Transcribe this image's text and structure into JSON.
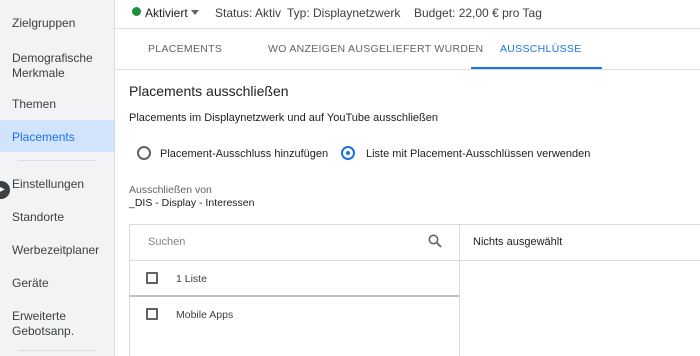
{
  "sidebar": {
    "items": [
      {
        "label": "Zielgruppen"
      },
      {
        "label": "Demografische Merkmale"
      },
      {
        "label": "Themen"
      },
      {
        "label": "Placements"
      },
      {
        "label": "Einstellungen"
      },
      {
        "label": "Standorte"
      },
      {
        "label": "Werbezeitplaner"
      },
      {
        "label": "Geräte"
      },
      {
        "label": "Erweiterte Gebotsanp."
      }
    ],
    "active_item": "Placements"
  },
  "status_bar": {
    "state": "Aktiviert",
    "status": "Status: Aktiv",
    "type": "Typ: Displaynetzwerk",
    "budget": "Budget: 22,00 € pro Tag"
  },
  "tabs": [
    {
      "label": "PLACEMENTS"
    },
    {
      "label": "WO ANZEIGEN AUSGELIEFERT WURDEN"
    },
    {
      "label": "AUSSCHLÜSSE"
    }
  ],
  "active_tab": "AUSSCHLÜSSE",
  "main": {
    "title": "Placements ausschließen",
    "subtitle": "Placements im Displaynetzwerk und auf YouTube ausschließen",
    "radio_options": [
      {
        "label": "Placement-Ausschluss hinzufügen",
        "checked": false
      },
      {
        "label": "Liste mit Placement-Ausschlüssen verwenden",
        "checked": true
      }
    ],
    "exclude_from_label": "Ausschließen von",
    "exclude_from_value": "_DIS - Display - Interessen",
    "search_placeholder": "Suchen",
    "right_header": "Nichts ausgewählt",
    "list_rows": [
      {
        "label": "1 Liste"
      },
      {
        "label": "Mobile Apps"
      }
    ]
  },
  "colors": {
    "accent": "#1a73e8",
    "status_green": "#1e8e3e",
    "sidebar_bg": "#f1f3f4",
    "active_bg": "#d2e3fc"
  }
}
